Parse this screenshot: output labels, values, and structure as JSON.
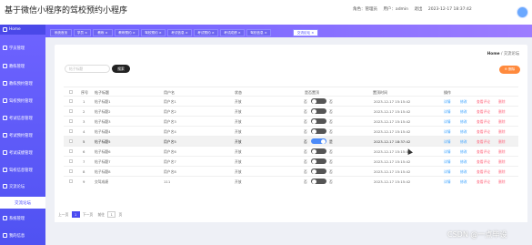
{
  "header": {
    "title": "基于微信小程序的驾校预约小程序"
  },
  "userinfo": {
    "role": "角色：管理员",
    "user": "用户：admin",
    "status": "退出",
    "datetime": "2023-12-17 18:37:42"
  },
  "sidebar": {
    "items": [
      {
        "label": "Home"
      },
      {
        "label": "学员管理"
      },
      {
        "label": "教练管理"
      },
      {
        "label": "教练预约管理"
      },
      {
        "label": "驾校预约管理"
      },
      {
        "label": "考试信息管理"
      },
      {
        "label": "考试预约管理"
      },
      {
        "label": "考试成绩管理"
      },
      {
        "label": "驾校信息管理"
      },
      {
        "label": "交流论坛"
      },
      {
        "label": "系统管理"
      },
      {
        "label": "我的信息"
      }
    ],
    "active_sub": "交流论坛"
  },
  "tabs": [
    {
      "label": "系统首页"
    },
    {
      "label": "学员 ×"
    },
    {
      "label": "教练 ×"
    },
    {
      "label": "教练预约 ×"
    },
    {
      "label": "驾校预约 ×"
    },
    {
      "label": "考试信息 ×"
    },
    {
      "label": "考试预约 ×"
    },
    {
      "label": "考试成绩 ×"
    },
    {
      "label": "驾校信息 ×"
    },
    {
      "label": "交流论坛 ×"
    }
  ],
  "breadcrumb": {
    "home": "Home",
    "sep": "/",
    "current": "交流论坛"
  },
  "search": {
    "placeholder": "帖子标题",
    "button": "搜索"
  },
  "toolbar": {
    "delete": "⊖ 删除"
  },
  "table": {
    "headers": [
      "序号",
      "帖子标题",
      "用户名",
      "状态",
      "是否置顶",
      "置顶时间",
      "操作"
    ],
    "rows": [
      {
        "no": "1",
        "title": "帖子标题1",
        "user": "用户名1",
        "status": "开放",
        "top": "否",
        "time": "2023-12-17 15:15:42"
      },
      {
        "no": "2",
        "title": "帖子标题2",
        "user": "用户名2",
        "status": "开放",
        "top": "否",
        "time": "2023-12-17 15:15:42"
      },
      {
        "no": "3",
        "title": "帖子标题3",
        "user": "用户名3",
        "status": "开放",
        "top": "否",
        "time": "2023-12-17 15:15:42"
      },
      {
        "no": "4",
        "title": "帖子标题4",
        "user": "用户名4",
        "status": "开放",
        "top": "否",
        "time": "2023-12-17 15:15:42"
      },
      {
        "no": "5",
        "title": "帖子标题5",
        "user": "用户名5",
        "status": "开放",
        "top": "是",
        "time": "2023-12-17 18:37:42"
      },
      {
        "no": "6",
        "title": "帖子标题6",
        "user": "用户名6",
        "status": "开放",
        "top": "否",
        "time": "2023-12-17 15:15:42"
      },
      {
        "no": "7",
        "title": "帖子标题7",
        "user": "用户名7",
        "status": "开放",
        "top": "否",
        "time": "2023-12-17 15:15:42"
      },
      {
        "no": "8",
        "title": "帖子标题8",
        "user": "用户名8",
        "status": "开放",
        "top": "否",
        "time": "2023-12-17 15:15:42"
      },
      {
        "no": "9",
        "title": "交驾成绩",
        "user": "111",
        "status": "开放",
        "top": "否",
        "time": "2023-12-17 15:15:42"
      }
    ],
    "ops": {
      "detail": "详情",
      "edit": "修改",
      "comment": "查看评论",
      "delete": "删除"
    },
    "toggle_prefix": "否"
  },
  "pager": {
    "prev": "上一页",
    "page": "1",
    "next": "下一页",
    "goto": "前往",
    "page_input": "1",
    "unit": "页"
  },
  "watermark": "CSDN @一点毕设",
  "colors": {
    "sidebar": "#5a55f5",
    "active_tab": "#ffffff",
    "toggle_on": "#4b8af8",
    "delete_btn": "#ff8a3d"
  }
}
